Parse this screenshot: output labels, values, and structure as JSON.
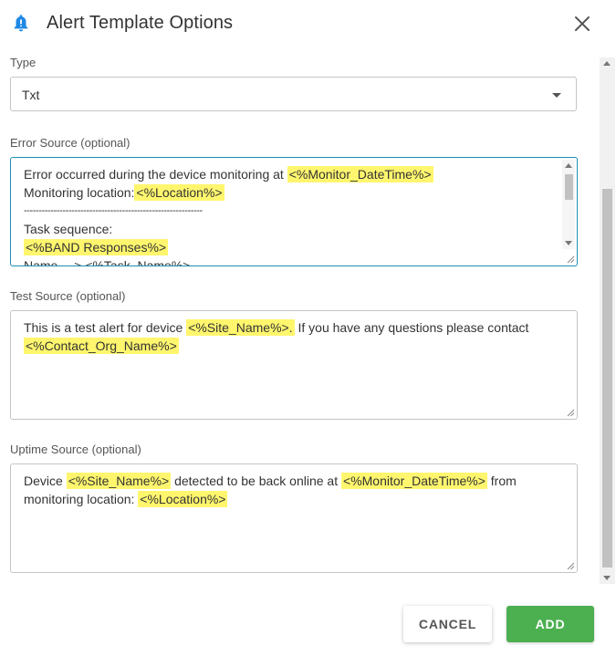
{
  "dialog": {
    "title": "Alert Template Options",
    "icon": "bell-icon",
    "accent_color": "#1e88e5"
  },
  "type_field": {
    "label": "Type",
    "value": "Txt"
  },
  "error_source": {
    "label": "Error Source (optional)",
    "line1_text": "Error occurred during the device monitoring at ",
    "line1_token": "<%Monitor_DateTime%>",
    "line2_text": "Monitoring location:",
    "line2_token": "<%Location%>",
    "separator": "------------------------------------------------------------",
    "line4_text": "Task sequence:",
    "line5_token": "<%BAND Responses%>",
    "line6_text": "Name ---> <%Task_Name%>"
  },
  "test_source": {
    "label": "Test Source (optional)",
    "text1": "This is a test alert for device ",
    "token1": "<%Site_Name%>.",
    "text2": " If you have any questions please contact",
    "token2": "<%Contact_Org_Name%>"
  },
  "uptime_source": {
    "label": "Uptime Source (optional)",
    "text1": "Device ",
    "token1": "<%Site_Name%>",
    "text2": " detected to be back online at ",
    "token2": "<%Monitor_DateTime%>",
    "text3": " from monitoring location: ",
    "token3": "<%Location%>"
  },
  "actions": {
    "cancel_label": "CANCEL",
    "add_label": "ADD",
    "add_color": "#4caf50"
  },
  "highlight_color": "#fff66e"
}
